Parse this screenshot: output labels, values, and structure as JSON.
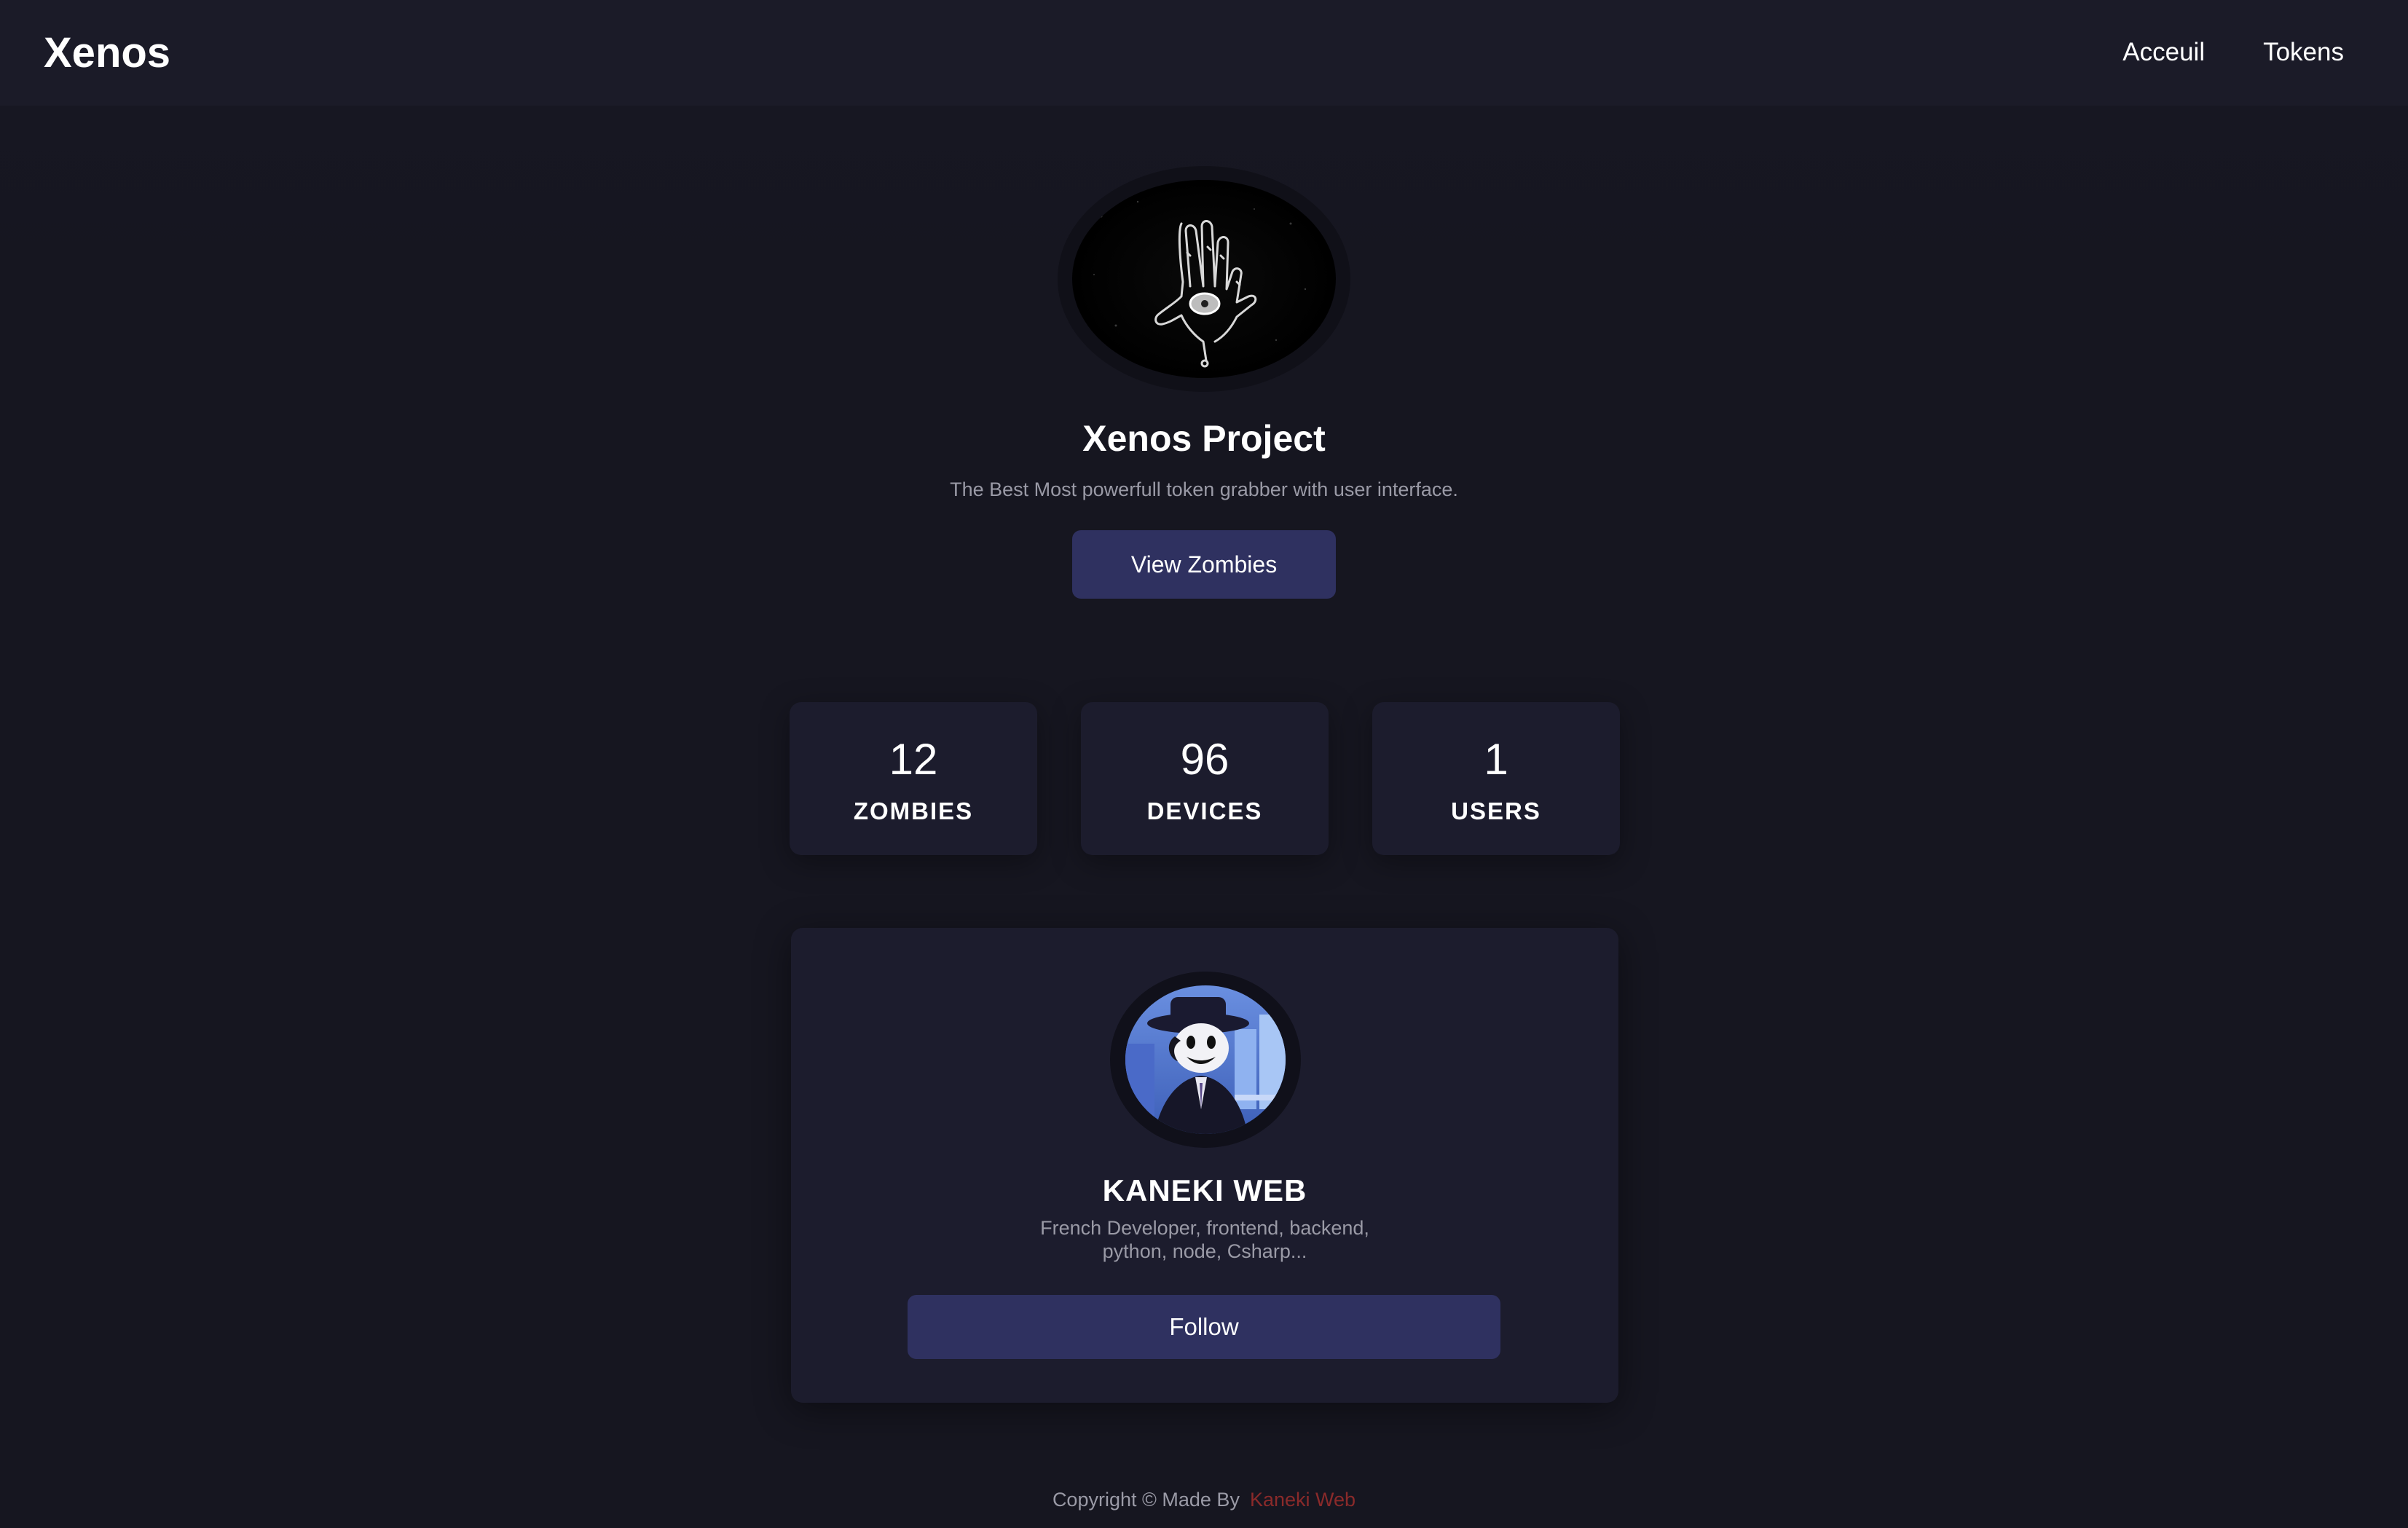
{
  "header": {
    "brand": "Xenos",
    "nav": [
      {
        "label": "Acceuil"
      },
      {
        "label": "Tokens"
      }
    ]
  },
  "hero": {
    "logo_icon": "occult-hand-eye-icon",
    "title": "Xenos Project",
    "subtitle": "The Best Most powerfull token grabber with user interface.",
    "button_label": "View Zombies"
  },
  "stats": [
    {
      "value": "12",
      "label": "ZOMBIES"
    },
    {
      "value": "96",
      "label": "DEVICES"
    },
    {
      "value": "1",
      "label": "USERS"
    }
  ],
  "profile": {
    "avatar_icon": "masked-character-avatar",
    "name": "KANEKI WEB",
    "bio": "French Developer, frontend, backend, python, node, Csharp...",
    "button_label": "Follow"
  },
  "footer": {
    "text": "Copyright © Made By",
    "author": "Kaneki Web"
  },
  "colors": {
    "background": "#161620",
    "card": "#1c1c2d",
    "button": "#2f3160",
    "muted_text": "#9a9aa6",
    "author_link": "#8a2a2a"
  }
}
